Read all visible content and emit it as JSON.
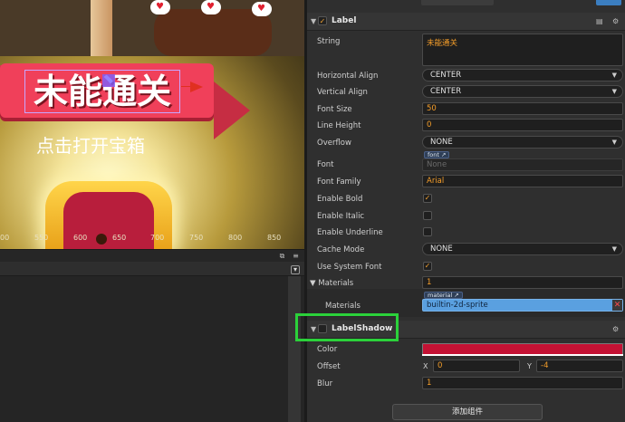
{
  "scene": {
    "title": "未能通关",
    "subtitle": "点击打开宝箱",
    "ruler_ticks": [
      "00",
      "550",
      "600",
      "650",
      "700",
      "750",
      "800",
      "850"
    ],
    "heart_glyph": "♥",
    "colors": {
      "banner": "#f0405a",
      "selection": "#c8a6ff",
      "arrow": "#e03020"
    }
  },
  "inspector": {
    "label_component": {
      "name": "Label",
      "checked_glyph": "✓",
      "collapse_glyph": "▼",
      "icons": [
        "book-icon",
        "gear-icon"
      ],
      "string_label": "String",
      "string_value": "未能通关",
      "h_align_label": "Horizontal Align",
      "h_align_value": "CENTER",
      "v_align_label": "Vertical Align",
      "v_align_value": "CENTER",
      "font_size_label": "Font Size",
      "font_size_value": "50",
      "line_height_label": "Line Height",
      "line_height_value": "0",
      "overflow_label": "Overflow",
      "overflow_value": "NONE",
      "font_label": "Font",
      "font_tag": "font ↗",
      "font_value": "None",
      "font_family_label": "Font Family",
      "font_family_value": "Arial",
      "enable_bold_label": "Enable Bold",
      "enable_bold_checked": true,
      "enable_italic_label": "Enable Italic",
      "enable_italic_checked": false,
      "enable_underline_label": "Enable Underline",
      "enable_underline_checked": false,
      "cache_mode_label": "Cache Mode",
      "cache_mode_value": "NONE",
      "use_system_font_label": "Use System Font",
      "use_system_font_checked": true,
      "materials_label": "Materials",
      "materials_count": "1",
      "materials_sub_label": "Materials",
      "material_tag": "material ↗",
      "material_value": "builtin-2d-sprite",
      "material_delete_glyph": "✕"
    },
    "label_shadow_component": {
      "name": "LabelShadow",
      "color_label": "Color",
      "offset_label": "Offset",
      "offset_x_axis": "X",
      "offset_x_value": "0",
      "offset_y_axis": "Y",
      "offset_y_value": "-4",
      "blur_label": "Blur",
      "blur_value": "1",
      "color_value": "#c41234"
    },
    "add_component_label": "添加组件",
    "highlight_color": "#2bd13a",
    "arrow_glyph": "▼",
    "check_glyph": "✓"
  }
}
